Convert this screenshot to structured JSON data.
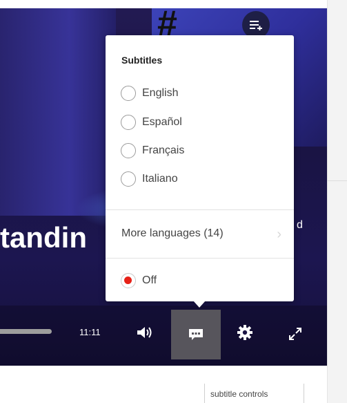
{
  "video": {
    "background_text": "tandin",
    "background_side_text": "d",
    "background_hash": "#"
  },
  "player": {
    "time": "11:11",
    "progress_fraction": 0.4,
    "icons": {
      "queue": "add-to-queue-icon",
      "volume": "volume-icon",
      "subtitles": "subtitles-icon",
      "settings": "gear-icon",
      "fullscreen": "fullscreen-icon"
    }
  },
  "subtitles_menu": {
    "title": "Subtitles",
    "options": [
      {
        "label": "English",
        "checked": false
      },
      {
        "label": "Español",
        "checked": false
      },
      {
        "label": "Français",
        "checked": false
      },
      {
        "label": "Italiano",
        "checked": false
      }
    ],
    "more_languages": "More languages (14)",
    "off": {
      "label": "Off",
      "checked": true
    }
  },
  "caption": "subtitle controls",
  "colors": {
    "accent": "#e62117",
    "cc_active_bg": "#57555c"
  }
}
